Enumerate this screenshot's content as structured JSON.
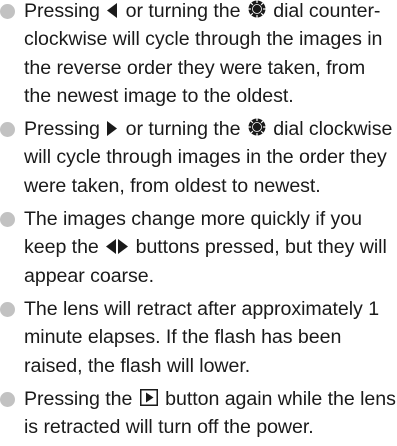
{
  "bullets": [
    {
      "text_a": "Pressing",
      "text_b": "or turning the",
      "text_c": "dial counter-clockwise will cycle through the images in the reverse order they were taken, from the newest image to the oldest."
    },
    {
      "text_a": "Pressing",
      "text_b": "or turning the",
      "text_c": "dial clockwise will cycle through images in the order they were taken, from oldest to newest."
    },
    {
      "text_a": "The images change more quickly if you keep the",
      "text_b": "buttons pressed, but they will appear coarse."
    },
    {
      "text_a": "The lens will retract after approximately 1 minute elapses. If the flash has been raised, the flash will lower."
    },
    {
      "text_a": "Pressing the",
      "text_b": "button again while the lens is retracted will turn off the power."
    }
  ],
  "icons": {
    "left": "left-arrow-icon",
    "right": "right-arrow-icon",
    "dial": "control-dial-icon",
    "left_right": "left-right-arrows-icon",
    "play": "playback-button-icon"
  },
  "colors": {
    "text": "#1a1a1a",
    "bullet": "#c2c2c2"
  }
}
